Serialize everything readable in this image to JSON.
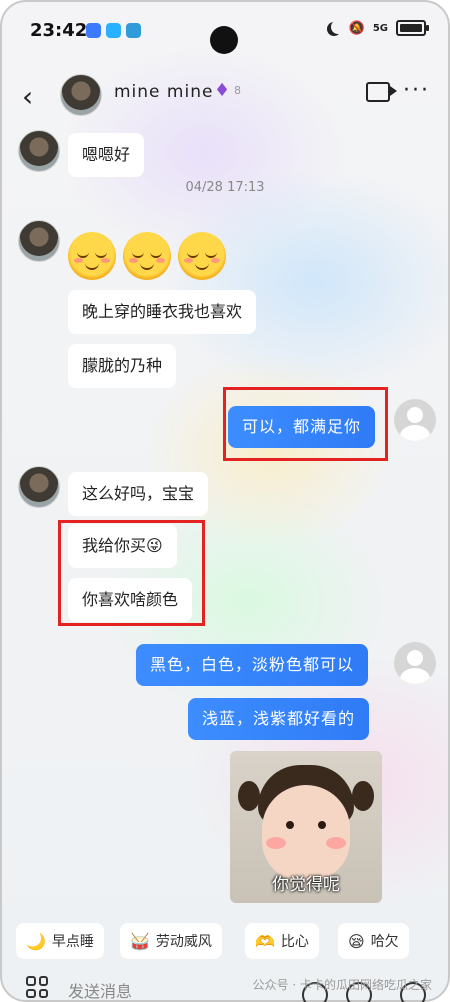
{
  "status_bar": {
    "time": "23:42",
    "network": "5G"
  },
  "header": {
    "title": "mine  mine",
    "level": "8"
  },
  "messages": {
    "m1": "嗯嗯好",
    "timestamp": "04/28 17:13",
    "m2": "晚上穿的睡衣我也喜欢",
    "m3": "朦胧的乃种",
    "m4": "可以，都满足你",
    "m5": "这么好吗，宝宝",
    "m6": "我给你买😜",
    "m7": "你喜欢啥颜色",
    "m8": "黑色，白色，淡粉色都可以",
    "m9": "浅蓝，浅紫都好看的",
    "photo_caption": "你觉得呢"
  },
  "quick_replies": [
    {
      "label": "早点睡",
      "icon": "🌙"
    },
    {
      "label": "劳动威风",
      "icon": "🥁"
    },
    {
      "label": "比心",
      "icon": "🫶"
    },
    {
      "label": "哈欠",
      "icon": "😪"
    }
  ],
  "input": {
    "placeholder": "发送消息"
  },
  "watermark": "公众号 · 卡卡的瓜田网络吃瓜之家",
  "colors": {
    "sent_bubble": "#2f7bf6",
    "highlight": "#e52222"
  }
}
